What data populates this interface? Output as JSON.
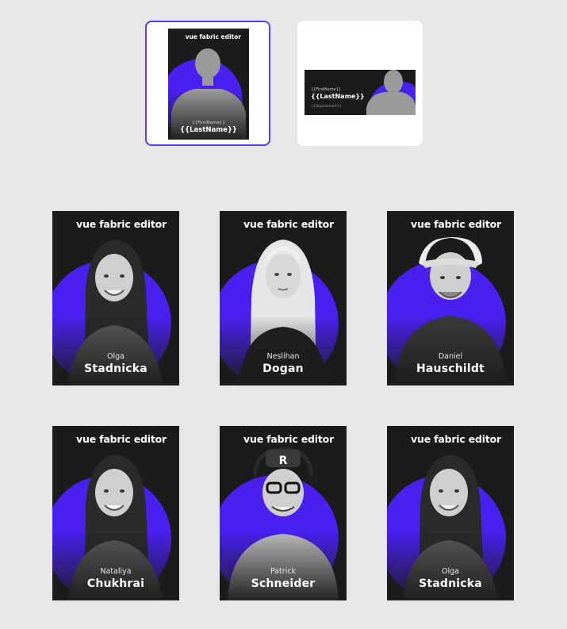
{
  "colors": {
    "background": "#e7e7e9",
    "accent": "#4a1ff0",
    "card": "#1b1b1b",
    "selected_border": "#5b3cf0"
  },
  "templates": [
    {
      "orientation": "portrait",
      "selected": true,
      "brand": "vue fabric editor",
      "first": "{{FirstName}}",
      "last": "{{LastName}}"
    },
    {
      "orientation": "landscape",
      "selected": false,
      "first": "{{FirstName}}",
      "last": "{{LastName}}",
      "department": "{{Department}}"
    }
  ],
  "cards": [
    {
      "brand": "vue fabric editor",
      "first": "Olga",
      "last": "Stadnicka",
      "photo": "woman-dark-hair-portrait"
    },
    {
      "brand": "vue fabric editor",
      "first": "Neslihan",
      "last": "Dogan",
      "photo": "woman-blonde-hair-portrait"
    },
    {
      "brand": "vue fabric editor",
      "first": "Daniel",
      "last": "Hauschildt",
      "photo": "man-white-cap-portrait"
    },
    {
      "brand": "vue fabric editor",
      "first": "Nataliya",
      "last": "Chukhrai",
      "photo": "woman-dark-hair-portrait"
    },
    {
      "brand": "vue fabric editor",
      "first": "Patrick",
      "last": "Schneider",
      "photo": "man-cap-glasses-portrait"
    },
    {
      "brand": "vue fabric editor",
      "first": "Olga",
      "last": "Stadnicka",
      "photo": "woman-dark-hair-portrait"
    }
  ]
}
